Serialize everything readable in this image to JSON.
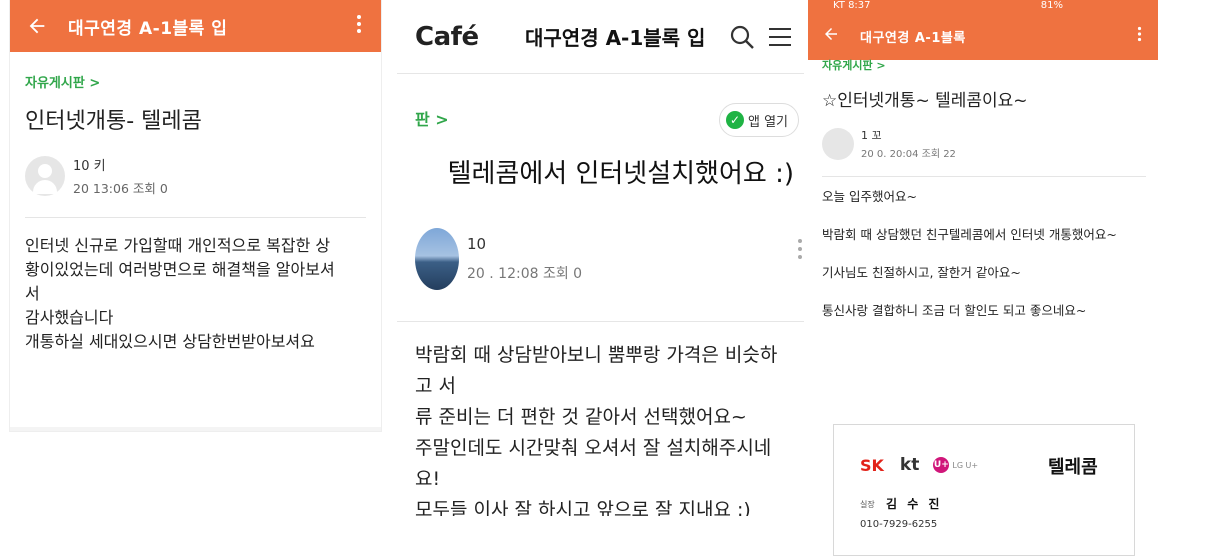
{
  "panel1": {
    "app_bar": {
      "title": "대구연경 A-1블록 입",
      "back_icon": "arrow-left-icon",
      "more_icon": "more-vertical-icon"
    },
    "board_link": "자유게시판 >",
    "post_title": "인터넷개통-   텔레콤",
    "author": {
      "name": "10   키",
      "meta": "20   13:06 조회 0"
    },
    "body_lines": [
      "인터넷 신규로 가입할때 개인적으로 복잡한 상",
      "황이있었는데 여러방면으로 해결책을 알아보셔",
      "서",
      "감사했습니다",
      "개통하실 세대있으시면 상담한번받아보셔요"
    ]
  },
  "panel2": {
    "logo": "Café",
    "header_title": "대구연경 A-1블록 입",
    "search_icon": "search-icon",
    "menu_icon": "hamburger-menu-icon",
    "board_link": "판 >",
    "open_app_label": "앱 열기",
    "post_title": "텔레콤에서 인터넷설치했어요 :)",
    "author": {
      "name": "10",
      "meta": "20   . 12:08 조회 0"
    },
    "body_lines": [
      "박람회 때 상담받아보니 뿜뿌랑 가격은 비슷하고 서",
      "류 준비는 더 편한 것 같아서 선택했어요~",
      "주말인데도 시간맞춰 오셔서 잘 설치해주시네요!",
      "모두들 이사 잘 하시고 앞으로 잘 지내요 :)"
    ]
  },
  "panel3": {
    "status_bar": {
      "left": "KT 8:37",
      "right": "81%"
    },
    "app_bar": {
      "title": "대구연경 A-1블록"
    },
    "board_link": "자유게시판 >",
    "post_title": "☆인터넷개통~   텔레콤이요~",
    "author": {
      "name": "1   꼬",
      "meta": "20   0. 20:04 조회 22"
    },
    "body_lines": [
      "오늘 입주했어요~",
      "박람회 때 상담했던 친구텔레콤에서 인터넷 개통했어요~",
      "기사님도 친절하시고, 잘한거 같아요~",
      "통신사랑 결합하니 조금 더 할인도 되고 좋으네요~"
    ],
    "card": {
      "sk": "SK",
      "kt": "kt",
      "lgu": "U+",
      "lgu_text": "LG U+",
      "brand": "텔레콤",
      "role": "실장",
      "name": "김 수 진",
      "phone": "010-7929-6255"
    }
  }
}
